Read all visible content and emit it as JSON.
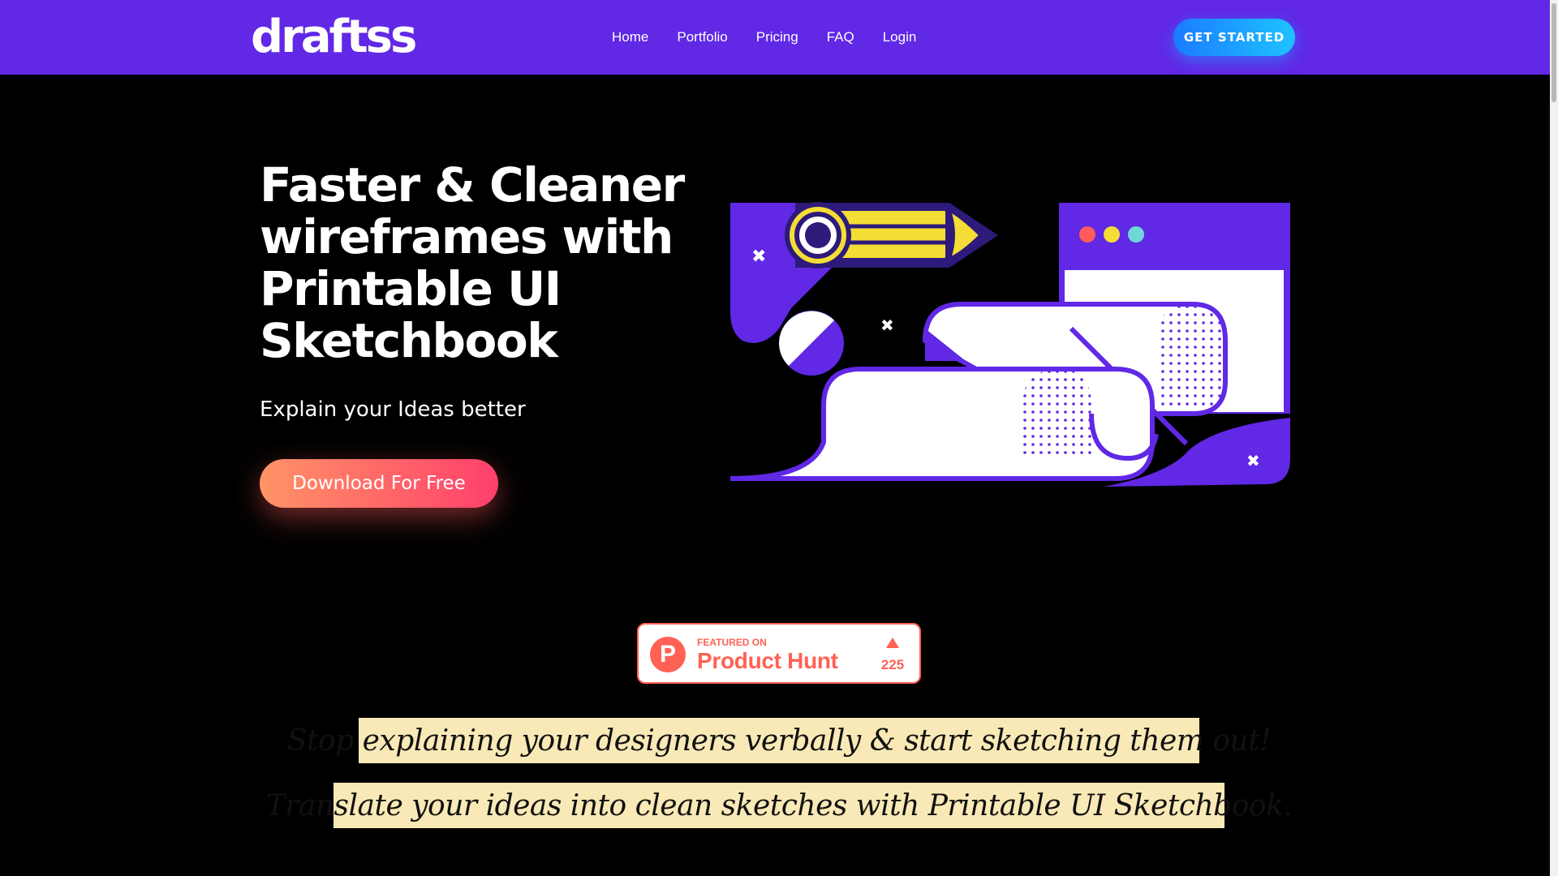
{
  "header": {
    "logo": "draftss",
    "nav": [
      "Home",
      "Portfolio",
      "Pricing",
      "FAQ",
      "Login"
    ],
    "cta_label": "GET STARTED"
  },
  "hero": {
    "title_lines": [
      "Faster & Cleaner",
      "wireframes with",
      "Printable UI",
      "Sketchbook"
    ],
    "subtitle": "Explain your Ideas better",
    "download_label": "Download For Free"
  },
  "product_hunt": {
    "featured": "FEATURED ON",
    "name": "Product Hunt",
    "votes": "225"
  },
  "banners": {
    "line1": "Stop explaining your designers verbally & start sketching them out!",
    "line2": "Translate your ideas into clean sketches with Printable UI Sketchbook."
  },
  "colors": {
    "header_bg": "#6128e6",
    "cta_gradient": [
      "#1b7bff",
      "#1ec3ff"
    ],
    "download_gradient": [
      "#ff9466",
      "#ff3f6b"
    ],
    "banner_bg": "#f9e9b6",
    "product_hunt": "#ff6154"
  },
  "icons": {
    "logo": "draftss-wordmark",
    "illustration": "pencil-browser-wireframe-illustration",
    "product_hunt": "product-hunt-p-icon",
    "upvote": "upvote-triangle-icon"
  }
}
